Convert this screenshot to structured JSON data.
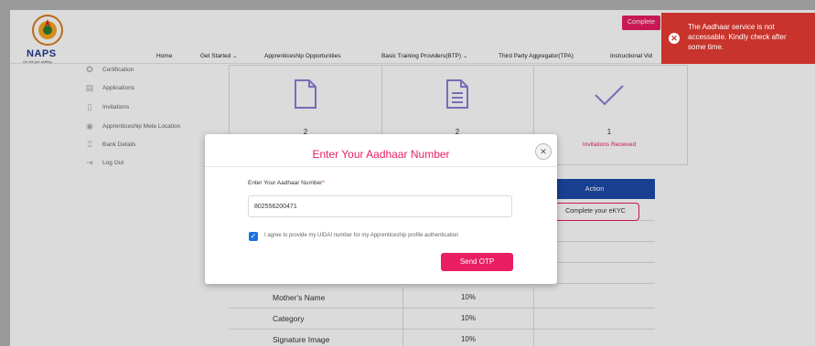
{
  "header": {
    "logo_text": "NAPS",
    "logo_tagline": "On the job skilling",
    "nav": [
      {
        "label": "Home"
      },
      {
        "label": "Get Started"
      },
      {
        "label": "Apprenticeship Opportunities"
      },
      {
        "label": "Basic Training Providers(BTP)"
      },
      {
        "label": "Third Party Aggregator(TPA)"
      },
      {
        "label": "Instructional Vid"
      }
    ],
    "complete_button": "Complete"
  },
  "sidebar": {
    "items": [
      {
        "label": "Certification"
      },
      {
        "label": "Applications"
      },
      {
        "label": "Invitations"
      },
      {
        "label": "Apprenticeship Mela Location"
      },
      {
        "label": "Bank Details"
      },
      {
        "label": "Log Out"
      }
    ]
  },
  "stats": [
    {
      "count": "2",
      "label": ""
    },
    {
      "count": "2",
      "label": ""
    },
    {
      "count": "1",
      "label": "Invitations Received"
    }
  ],
  "table": {
    "action_header": "Action",
    "kyc_button": "Complete your eKYC",
    "rows": [
      {
        "name": "Mother's Name",
        "value": "10%"
      },
      {
        "name": "Category",
        "value": "10%"
      },
      {
        "name": "Signature Image",
        "value": "10%"
      }
    ]
  },
  "modal": {
    "title": "Enter Your Aadhaar Number",
    "field_label": "Enter Your Aadhaar Number",
    "aadhaar_value": "802556200471",
    "agree_text": "I agree to provide my UIDAI number for my Apprenticeship profile authentication",
    "send_button": "Send OTP"
  },
  "toast": {
    "message": "The Aadhaar service is not accessable. Kindly check after some time."
  },
  "colors": {
    "accent": "#e91e63",
    "primary_blue": "#1e4aa8",
    "toast_red": "#c8332b"
  }
}
